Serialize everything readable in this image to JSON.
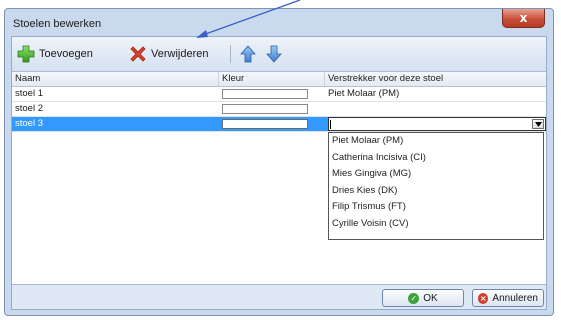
{
  "window": {
    "title": "Stoelen bewerken",
    "close_glyph": "x"
  },
  "toolbar": {
    "add_label": "Toevoegen",
    "remove_label": "Verwijderen",
    "add_icon": "plus-icon",
    "remove_icon": "red-x-icon",
    "up_icon": "arrow-up-icon",
    "down_icon": "arrow-down-icon"
  },
  "grid": {
    "columns": [
      "Naam",
      "Kleur",
      "Verstrekker voor deze stoel"
    ],
    "rows": [
      {
        "name": "stoel 1",
        "provider": "Piet Molaar (PM)"
      },
      {
        "name": "stoel 2",
        "provider": ""
      },
      {
        "name": "stoel 3",
        "provider": ""
      }
    ],
    "selected_row": 2
  },
  "dropdown": {
    "options": [
      "Piet Molaar (PM)",
      "Catherina Incisiva (CI)",
      "Mies Gingiva (MG)",
      "Dries Kies (DK)",
      "Filip Trismus (FT)",
      "Cyrille Voisin (CV)"
    ]
  },
  "footer": {
    "ok_label": "OK",
    "cancel_label": "Annuleren"
  },
  "colors": {
    "selection": "#3399ff",
    "window_bg": "#c9d9ee",
    "close_red": "#c7503a",
    "annotation_arrow": "#3a5fc8"
  }
}
